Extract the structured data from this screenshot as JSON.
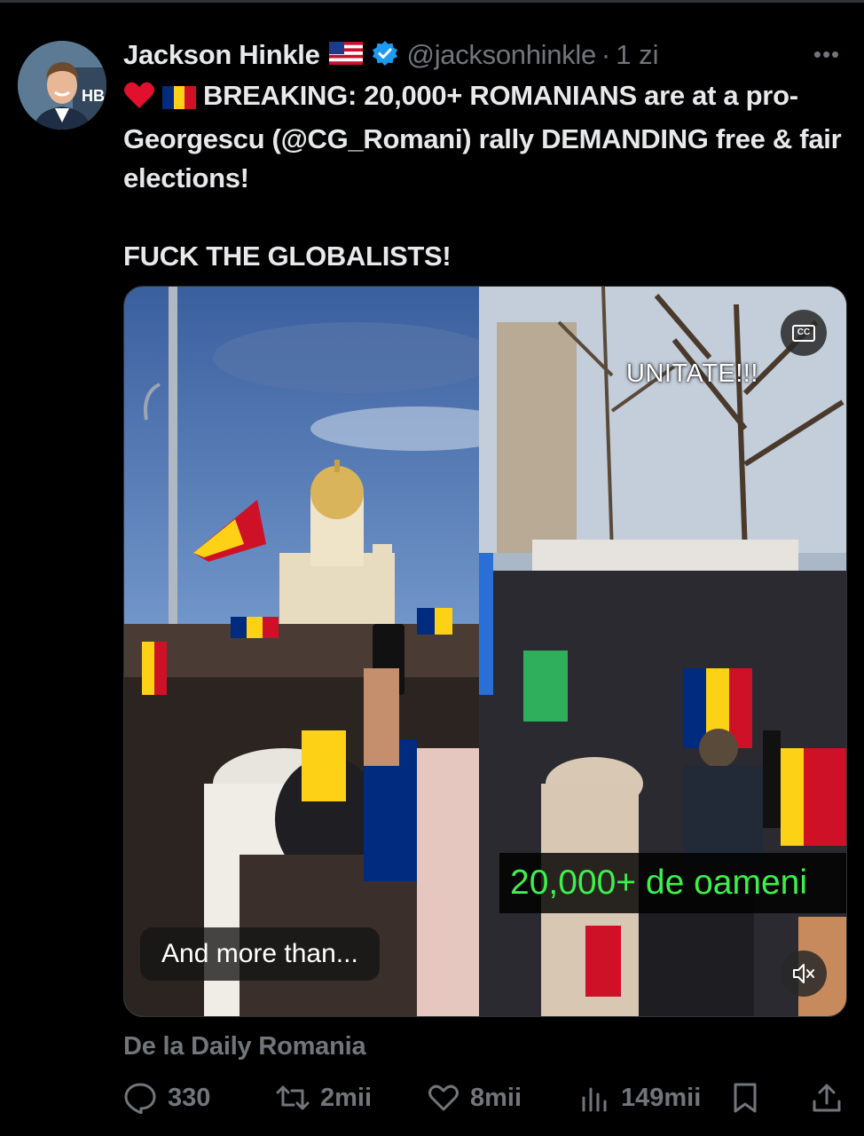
{
  "post": {
    "author_name": "Jackson Hinkle",
    "handle": "@jacksonhinkle",
    "separator": "·",
    "time": "1 zi",
    "more_label": "•••",
    "text_line1": "BREAKING: 20,000+ ROMANIANS are at a pro-Georgescu (@CG_Romani) rally DEMANDING free & fair elections!",
    "text_line2": "FUCK THE GLOBALISTS!",
    "source": "De la Daily Romania"
  },
  "media": {
    "overlay_top": "UNITATE!!!",
    "overlay_count": "20,000+ de oameni",
    "caption": "And more than...",
    "cc_label": "CC"
  },
  "actions": {
    "replies": "330",
    "reposts": "2mii",
    "likes": "8mii",
    "views": "149mii"
  },
  "colors": {
    "background": "#000000",
    "text": "#e7e9ea",
    "muted": "#71767b",
    "verified": "#1d9bf0",
    "overlay_green": "#3df04a"
  },
  "icons": [
    "us-flag-icon",
    "verified-badge-icon",
    "heart-emoji-icon",
    "romania-flag-icon",
    "cc-icon",
    "mute-icon",
    "reply-icon",
    "repost-icon",
    "like-icon",
    "views-icon",
    "bookmark-icon",
    "share-icon"
  ]
}
